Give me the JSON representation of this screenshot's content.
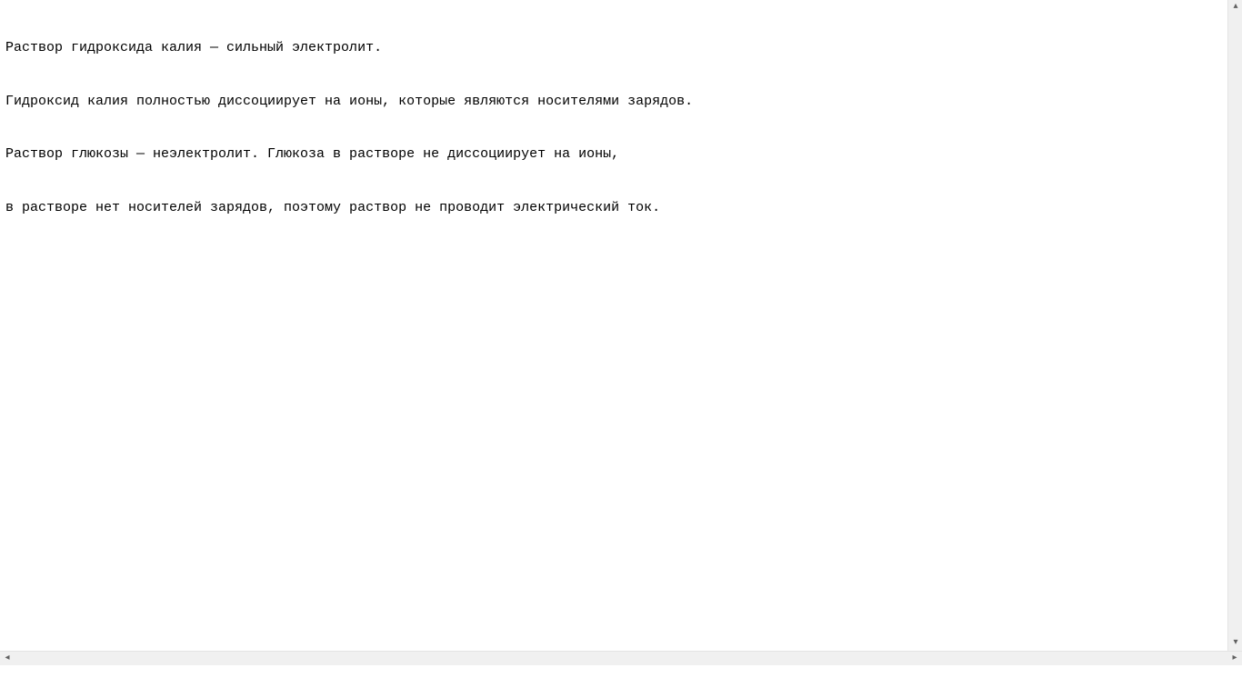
{
  "content": {
    "lines": [
      "Раствор гидроксида калия — сильный электролит.",
      "Гидроксид калия полностью диссоциирует на ионы, которые являются носителями зарядов.",
      "Раствор глюкозы — неэлектролит. Глюкоза в растворе не диссоциирует на ионы,",
      "в растворе нет носителей зарядов, поэтому раствор не проводит электрический ток."
    ]
  },
  "scrollbar": {
    "up_glyph": "▴",
    "down_glyph": "▾",
    "left_glyph": "◂",
    "right_glyph": "▸"
  }
}
